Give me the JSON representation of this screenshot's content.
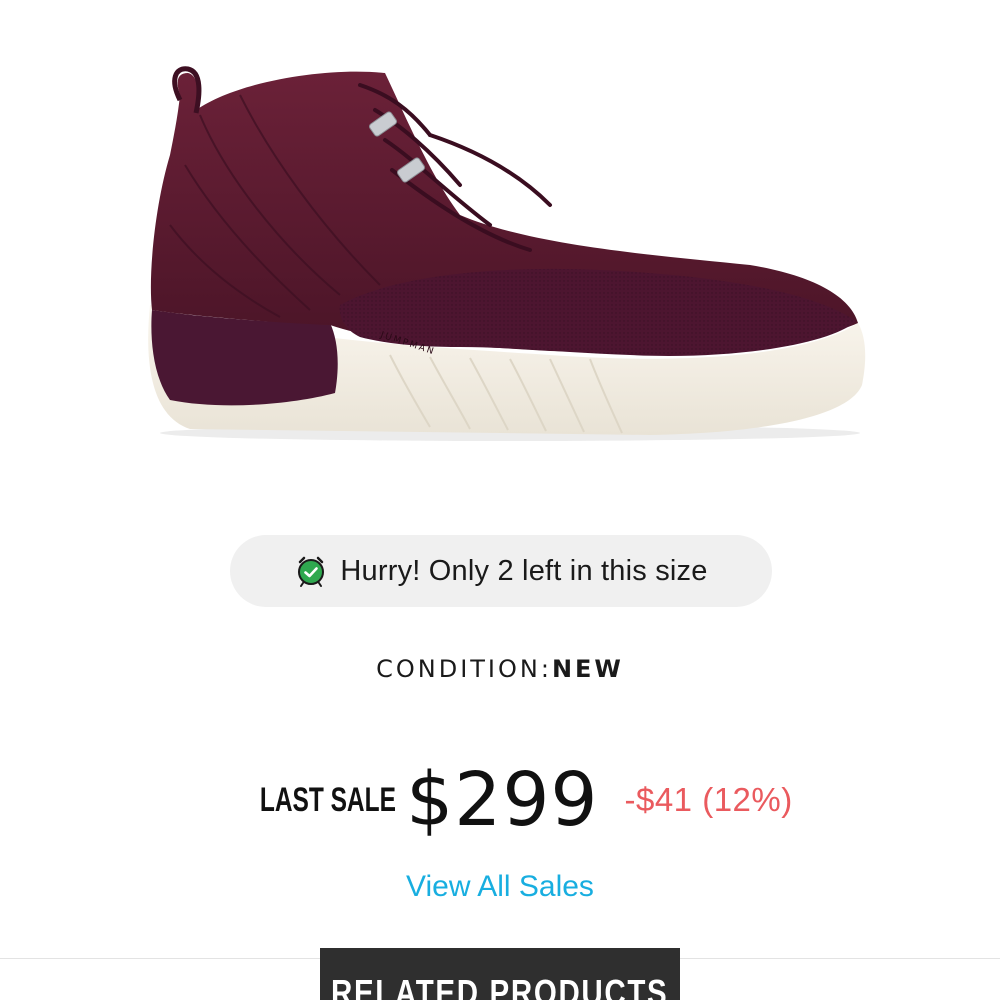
{
  "product": {
    "image_alt": "sneaker-product-image",
    "colors": {
      "suede": "#5a1a2e",
      "sole": "#f4efe4",
      "eyelets": "#c9ccd1"
    },
    "midsole_brand_text": "JUMPMAN"
  },
  "scarcity": {
    "icon": "alarm-clock-icon",
    "text": "Hurry! Only 2 left in this size"
  },
  "condition": {
    "label": "CONDITION:",
    "value": "NEW"
  },
  "last_sale": {
    "label": "LAST SALE",
    "price": "$299",
    "change": "-$41 (12%)"
  },
  "links": {
    "view_all_sales": "View All Sales"
  },
  "related": {
    "tab_label": "RELATED PRODUCTS"
  },
  "colors": {
    "accent_link": "#18aee0",
    "negative_change": "#ea5a5e",
    "pill_background": "#f0f0f0",
    "tab_background": "#2f2f2f",
    "alarm_green": "#2fa84f"
  }
}
